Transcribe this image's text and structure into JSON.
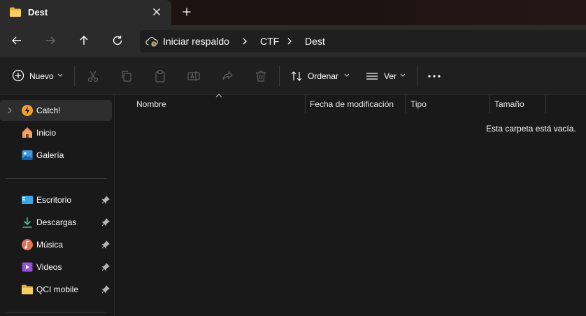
{
  "tab": {
    "title": "Dest",
    "close_icon": "close-icon",
    "new_tab_icon": "plus-icon"
  },
  "nav": {
    "back_icon": "arrow-left-icon",
    "forward_icon": "arrow-right-icon",
    "up_icon": "arrow-up-icon",
    "refresh_icon": "refresh-icon"
  },
  "breadcrumb": [
    "Iniciar respaldo",
    "CTF",
    "Dest"
  ],
  "toolbar": {
    "new_label": "Nuevo",
    "sort_label": "Ordenar",
    "view_label": "Ver",
    "icons": [
      "cut-icon",
      "copy-icon",
      "paste-icon",
      "rename-icon",
      "share-icon",
      "delete-icon",
      "more-icon"
    ]
  },
  "sidebar": {
    "top_items": [
      {
        "label": "Catch!",
        "icon": "bolt-icon"
      },
      {
        "label": "Inicio",
        "icon": "home-icon"
      },
      {
        "label": "Galería",
        "icon": "gallery-icon"
      }
    ],
    "pinned_items": [
      {
        "label": "Escritorio",
        "icon": "desktop-icon"
      },
      {
        "label": "Descargas",
        "icon": "download-icon"
      },
      {
        "label": "Música",
        "icon": "music-icon"
      },
      {
        "label": "Videos",
        "icon": "video-icon"
      },
      {
        "label": "QCI mobile",
        "icon": "folder-icon"
      }
    ]
  },
  "columns": [
    "Nombre",
    "Fecha de modificación",
    "Tipo",
    "Tamaño"
  ],
  "empty_message": "Esta carpeta está vacía.",
  "colors": {
    "accent_folder": "#f2c55c",
    "background": "#191919",
    "toolbar_bg": "#1f1f1f",
    "tab_bg": "#2b2b2b"
  }
}
